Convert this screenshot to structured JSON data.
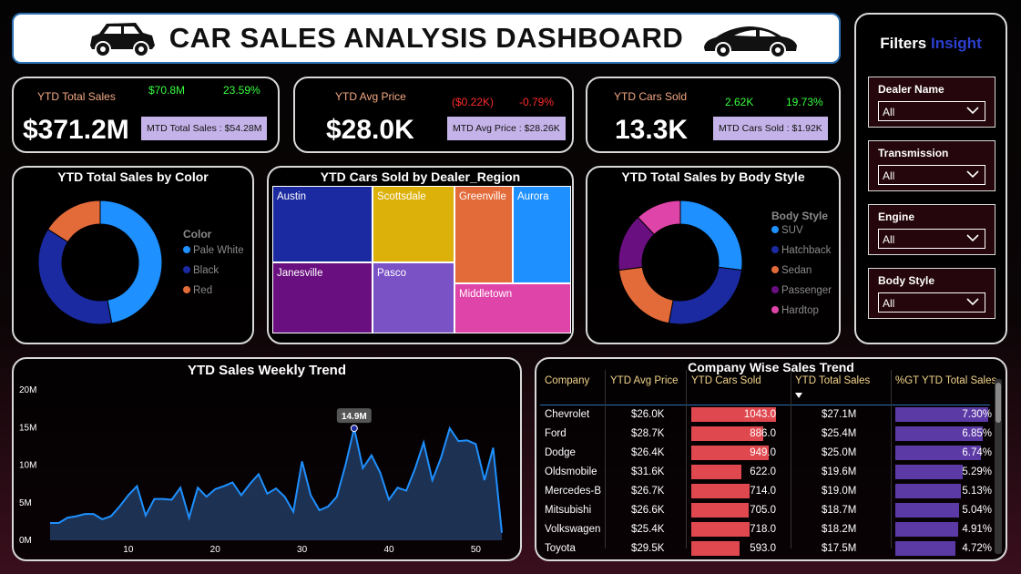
{
  "header": {
    "title": "CAR SALES ANALYSIS DASHBOARD"
  },
  "kpis": [
    {
      "label": "YTD Total Sales",
      "value": "$371.2M",
      "change_value": "$70.8M",
      "change_pct": "23.59%",
      "change_dir": "pos",
      "mtd": "MTD Total Sales : $54.28M"
    },
    {
      "label": "YTD Avg Price",
      "value": "$28.0K",
      "change_value": "($0.22K)",
      "change_pct": "-0.79%",
      "change_dir": "neg",
      "mtd": "MTD Avg Price : $28.26K"
    },
    {
      "label": "YTD Cars Sold",
      "value": "13.3K",
      "change_value": "2.62K",
      "change_pct": "19.73%",
      "change_dir": "pos",
      "mtd": "MTD Cars Sold : $1.92K"
    }
  ],
  "filters": {
    "title_a": "Filters",
    "title_b": "Insight",
    "items": [
      {
        "label": "Dealer Name",
        "value": "All"
      },
      {
        "label": "Transmission",
        "value": "All"
      },
      {
        "label": "Engine",
        "value": "All"
      },
      {
        "label": "Body Style",
        "value": "All"
      }
    ]
  },
  "colors": {
    "pale_white": "#1e90ff",
    "black": "#1b2aa0",
    "red": "#e36b3a",
    "suv": "#1e90ff",
    "hatchback": "#1b2aa0",
    "sedan": "#e36b3a",
    "passenger": "#6a0f80",
    "hardtop": "#df44a8",
    "line": "#1e90ff",
    "area": "#1d3253",
    "bar_red": "#e0484f",
    "bar_purple": "#5b3aa5"
  },
  "chart_data": [
    {
      "type": "pie",
      "title": "YTD Total Sales by Color",
      "legend_title": "Color",
      "legend_position": "right",
      "categories": [
        "Pale White",
        "Black",
        "Red"
      ],
      "values": [
        47,
        37,
        16
      ]
    },
    {
      "type": "treemap",
      "title": "YTD Cars Sold by Dealer_Region",
      "categories": [
        "Austin",
        "Janesville",
        "Scottsdale",
        "Pasco",
        "Greenville",
        "Aurora",
        "Middletown"
      ],
      "values": [
        1.82,
        1.73,
        1.58,
        1.52,
        1.43,
        1.47,
        1.42
      ]
    },
    {
      "type": "pie",
      "title": "YTD Total Sales by Body Style",
      "legend_title": "Body Style",
      "legend_position": "right",
      "categories": [
        "SUV",
        "Hatchback",
        "Sedan",
        "Passenger",
        "Hardtop"
      ],
      "values": [
        27,
        26,
        20,
        15,
        12
      ]
    },
    {
      "type": "area",
      "title": "YTD Sales Weekly Trend",
      "x": [
        1,
        2,
        3,
        4,
        5,
        6,
        7,
        8,
        9,
        10,
        11,
        12,
        13,
        14,
        15,
        16,
        17,
        18,
        19,
        20,
        21,
        22,
        23,
        24,
        25,
        26,
        27,
        28,
        29,
        30,
        31,
        32,
        33,
        34,
        35,
        36,
        37,
        38,
        39,
        40,
        41,
        42,
        43,
        44,
        45,
        46,
        47,
        48,
        49,
        50,
        51,
        52,
        53
      ],
      "values": [
        2.3,
        2.3,
        3.0,
        3.2,
        3.5,
        3.5,
        2.8,
        3.2,
        4.5,
        6.0,
        7.2,
        3.3,
        5.5,
        5.5,
        5.4,
        7.0,
        3.0,
        7.0,
        5.8,
        6.8,
        7.2,
        7.7,
        6.0,
        7.5,
        8.8,
        6.2,
        6.9,
        5.8,
        3.8,
        10.5,
        6.0,
        4.0,
        4.5,
        5.8,
        10.0,
        14.9,
        9.6,
        11.3,
        9.0,
        5.4,
        7.0,
        6.6,
        9.5,
        13.0,
        8.0,
        11.0,
        14.9,
        13.2,
        13.3,
        12.8,
        8.0,
        12.3,
        1.0
      ],
      "annotation": {
        "x": 36,
        "label": "14.9M"
      },
      "ylim": [
        0,
        20
      ],
      "yticks": [
        "0M",
        "5M",
        "10M",
        "15M",
        "20M"
      ],
      "xticks": [
        10,
        20,
        30,
        40,
        50
      ],
      "grid": false
    },
    {
      "type": "table",
      "title": "Company Wise Sales Trend",
      "columns": [
        "Company",
        "YTD Avg Price",
        "YTD Cars Sold",
        "YTD Total Sales",
        "%GT YTD Total Sales"
      ],
      "rows": [
        {
          "company": "Chevrolet",
          "avg_price": "$26.0K",
          "cars_sold": 1043.0,
          "cars_sold_label": "1043.0",
          "total_sales": "$27.1M",
          "gt_pct": 7.3,
          "gt_label": "7.30%"
        },
        {
          "company": "Ford",
          "avg_price": "$28.7K",
          "cars_sold": 886.0,
          "cars_sold_label": "886.0",
          "total_sales": "$25.4M",
          "gt_pct": 6.85,
          "gt_label": "6.85%"
        },
        {
          "company": "Dodge",
          "avg_price": "$26.4K",
          "cars_sold": 949.0,
          "cars_sold_label": "949.0",
          "total_sales": "$25.0M",
          "gt_pct": 6.74,
          "gt_label": "6.74%"
        },
        {
          "company": "Oldsmobile",
          "avg_price": "$31.6K",
          "cars_sold": 622.0,
          "cars_sold_label": "622.0",
          "total_sales": "$19.6M",
          "gt_pct": 5.29,
          "gt_label": "5.29%"
        },
        {
          "company": "Mercedes-B",
          "avg_price": "$26.7K",
          "cars_sold": 714.0,
          "cars_sold_label": "714.0",
          "total_sales": "$19.0M",
          "gt_pct": 5.13,
          "gt_label": "5.13%"
        },
        {
          "company": "Mitsubishi",
          "avg_price": "$26.6K",
          "cars_sold": 705.0,
          "cars_sold_label": "705.0",
          "total_sales": "$18.7M",
          "gt_pct": 5.04,
          "gt_label": "5.04%"
        },
        {
          "company": "Volkswagen",
          "avg_price": "$25.4K",
          "cars_sold": 718.0,
          "cars_sold_label": "718.0",
          "total_sales": "$18.2M",
          "gt_pct": 4.91,
          "gt_label": "4.91%"
        },
        {
          "company": "Toyota",
          "avg_price": "$29.5K",
          "cars_sold": 593.0,
          "cars_sold_label": "593.0",
          "total_sales": "$17.5M",
          "gt_pct": 4.72,
          "gt_label": "4.72%"
        }
      ]
    }
  ]
}
